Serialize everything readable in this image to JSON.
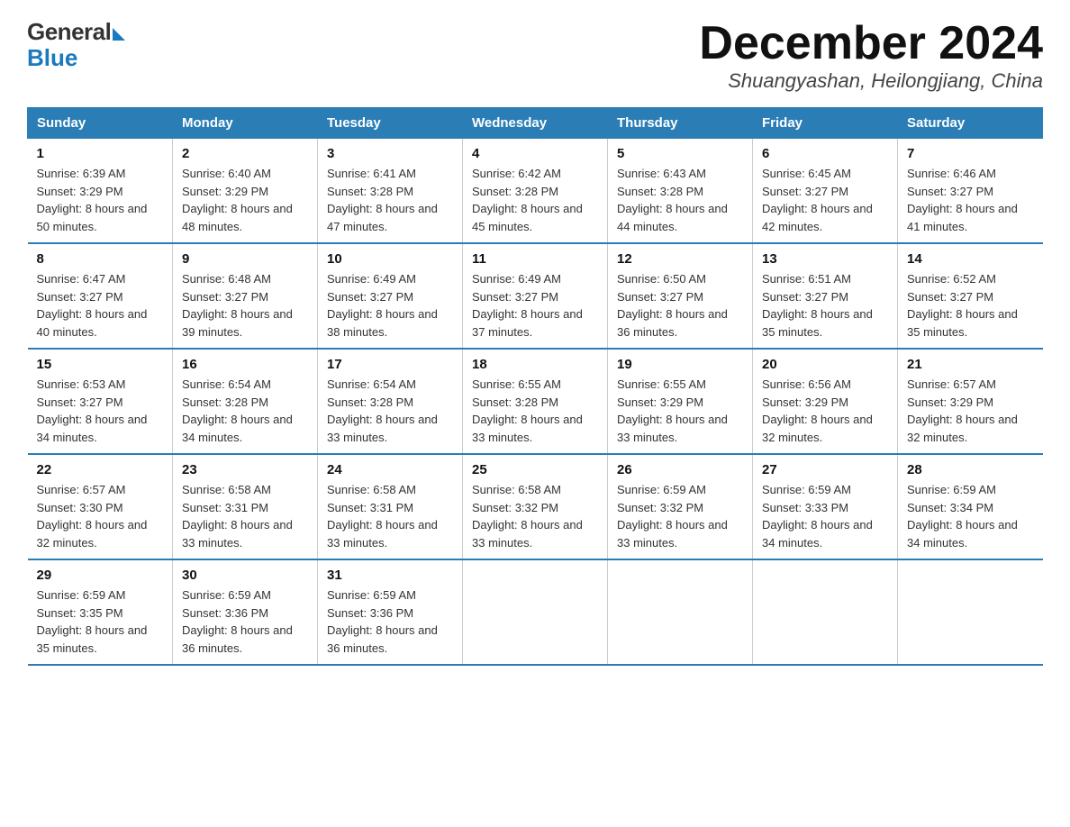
{
  "logo": {
    "general": "General",
    "blue": "Blue"
  },
  "title": "December 2024",
  "location": "Shuangyashan, Heilongjiang, China",
  "headers": [
    "Sunday",
    "Monday",
    "Tuesday",
    "Wednesday",
    "Thursday",
    "Friday",
    "Saturday"
  ],
  "weeks": [
    [
      {
        "day": "1",
        "sunrise": "6:39 AM",
        "sunset": "3:29 PM",
        "daylight": "8 hours and 50 minutes."
      },
      {
        "day": "2",
        "sunrise": "6:40 AM",
        "sunset": "3:29 PM",
        "daylight": "8 hours and 48 minutes."
      },
      {
        "day": "3",
        "sunrise": "6:41 AM",
        "sunset": "3:28 PM",
        "daylight": "8 hours and 47 minutes."
      },
      {
        "day": "4",
        "sunrise": "6:42 AM",
        "sunset": "3:28 PM",
        "daylight": "8 hours and 45 minutes."
      },
      {
        "day": "5",
        "sunrise": "6:43 AM",
        "sunset": "3:28 PM",
        "daylight": "8 hours and 44 minutes."
      },
      {
        "day": "6",
        "sunrise": "6:45 AM",
        "sunset": "3:27 PM",
        "daylight": "8 hours and 42 minutes."
      },
      {
        "day": "7",
        "sunrise": "6:46 AM",
        "sunset": "3:27 PM",
        "daylight": "8 hours and 41 minutes."
      }
    ],
    [
      {
        "day": "8",
        "sunrise": "6:47 AM",
        "sunset": "3:27 PM",
        "daylight": "8 hours and 40 minutes."
      },
      {
        "day": "9",
        "sunrise": "6:48 AM",
        "sunset": "3:27 PM",
        "daylight": "8 hours and 39 minutes."
      },
      {
        "day": "10",
        "sunrise": "6:49 AM",
        "sunset": "3:27 PM",
        "daylight": "8 hours and 38 minutes."
      },
      {
        "day": "11",
        "sunrise": "6:49 AM",
        "sunset": "3:27 PM",
        "daylight": "8 hours and 37 minutes."
      },
      {
        "day": "12",
        "sunrise": "6:50 AM",
        "sunset": "3:27 PM",
        "daylight": "8 hours and 36 minutes."
      },
      {
        "day": "13",
        "sunrise": "6:51 AM",
        "sunset": "3:27 PM",
        "daylight": "8 hours and 35 minutes."
      },
      {
        "day": "14",
        "sunrise": "6:52 AM",
        "sunset": "3:27 PM",
        "daylight": "8 hours and 35 minutes."
      }
    ],
    [
      {
        "day": "15",
        "sunrise": "6:53 AM",
        "sunset": "3:27 PM",
        "daylight": "8 hours and 34 minutes."
      },
      {
        "day": "16",
        "sunrise": "6:54 AM",
        "sunset": "3:28 PM",
        "daylight": "8 hours and 34 minutes."
      },
      {
        "day": "17",
        "sunrise": "6:54 AM",
        "sunset": "3:28 PM",
        "daylight": "8 hours and 33 minutes."
      },
      {
        "day": "18",
        "sunrise": "6:55 AM",
        "sunset": "3:28 PM",
        "daylight": "8 hours and 33 minutes."
      },
      {
        "day": "19",
        "sunrise": "6:55 AM",
        "sunset": "3:29 PM",
        "daylight": "8 hours and 33 minutes."
      },
      {
        "day": "20",
        "sunrise": "6:56 AM",
        "sunset": "3:29 PM",
        "daylight": "8 hours and 32 minutes."
      },
      {
        "day": "21",
        "sunrise": "6:57 AM",
        "sunset": "3:29 PM",
        "daylight": "8 hours and 32 minutes."
      }
    ],
    [
      {
        "day": "22",
        "sunrise": "6:57 AM",
        "sunset": "3:30 PM",
        "daylight": "8 hours and 32 minutes."
      },
      {
        "day": "23",
        "sunrise": "6:58 AM",
        "sunset": "3:31 PM",
        "daylight": "8 hours and 33 minutes."
      },
      {
        "day": "24",
        "sunrise": "6:58 AM",
        "sunset": "3:31 PM",
        "daylight": "8 hours and 33 minutes."
      },
      {
        "day": "25",
        "sunrise": "6:58 AM",
        "sunset": "3:32 PM",
        "daylight": "8 hours and 33 minutes."
      },
      {
        "day": "26",
        "sunrise": "6:59 AM",
        "sunset": "3:32 PM",
        "daylight": "8 hours and 33 minutes."
      },
      {
        "day": "27",
        "sunrise": "6:59 AM",
        "sunset": "3:33 PM",
        "daylight": "8 hours and 34 minutes."
      },
      {
        "day": "28",
        "sunrise": "6:59 AM",
        "sunset": "3:34 PM",
        "daylight": "8 hours and 34 minutes."
      }
    ],
    [
      {
        "day": "29",
        "sunrise": "6:59 AM",
        "sunset": "3:35 PM",
        "daylight": "8 hours and 35 minutes."
      },
      {
        "day": "30",
        "sunrise": "6:59 AM",
        "sunset": "3:36 PM",
        "daylight": "8 hours and 36 minutes."
      },
      {
        "day": "31",
        "sunrise": "6:59 AM",
        "sunset": "3:36 PM",
        "daylight": "8 hours and 36 minutes."
      },
      null,
      null,
      null,
      null
    ]
  ],
  "labels": {
    "sunrise": "Sunrise:",
    "sunset": "Sunset:",
    "daylight": "Daylight:"
  }
}
